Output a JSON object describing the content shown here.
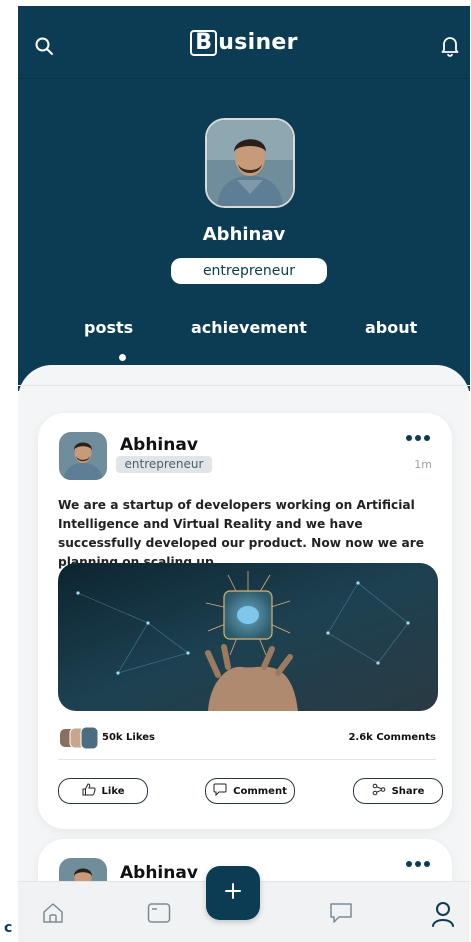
{
  "header": {
    "logo_letter": "B",
    "logo_rest": "usiner",
    "search_icon": "search-icon",
    "notification_icon": "bell-icon"
  },
  "profile": {
    "name": "Abhinav",
    "role": "entrepreneur"
  },
  "tabs": [
    {
      "label": "posts",
      "active": true
    },
    {
      "label": "achievement",
      "active": false
    },
    {
      "label": "about",
      "active": false
    }
  ],
  "posts": [
    {
      "author": "Abhinav",
      "role": "entrepreneur",
      "time": "1m",
      "text": "We are a startup of developers working on Artificial Intelligence and Virtual Reality and we have successfully developed our product. Now now we are planning on scaling up.",
      "likes": "50k Likes",
      "comments": "2.6k Comments",
      "actions": {
        "like": "Like",
        "comment": "Comment",
        "share": "Share"
      }
    },
    {
      "author": "Abhinav"
    }
  ],
  "bottom_nav": {
    "items": [
      "home-icon",
      "card-icon",
      "add-icon",
      "chat-icon",
      "profile-icon"
    ],
    "active": "profile-icon"
  },
  "corner_text": "c",
  "colors": {
    "primary": "#0c3b54",
    "background": "#f4f5f6",
    "card": "#ffffff"
  }
}
